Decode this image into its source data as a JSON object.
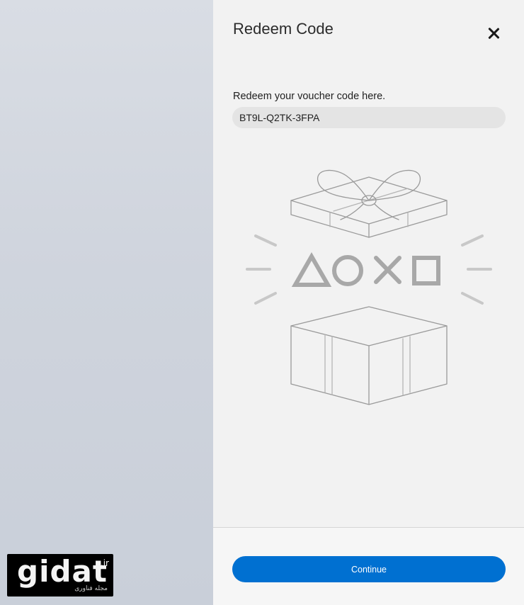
{
  "dialog": {
    "title": "Redeem Code",
    "prompt": "Redeem your voucher code here.",
    "code_value": "BT9L-Q2TK-3FPA",
    "continue_label": "Continue",
    "close_icon": "close-icon"
  },
  "illustration": {
    "icons": [
      "gift-lid-icon",
      "triangle-icon",
      "circle-icon",
      "cross-icon",
      "square-icon",
      "gift-box-icon"
    ]
  },
  "watermark": {
    "brand": "gidat",
    "tld": ".ir",
    "tagline": "مجله فناوری"
  },
  "colors": {
    "accent": "#0070d1",
    "panel_bg": "#f2f2f2",
    "input_bg": "#e4e4e4",
    "line_art": "#9a9a9a"
  }
}
